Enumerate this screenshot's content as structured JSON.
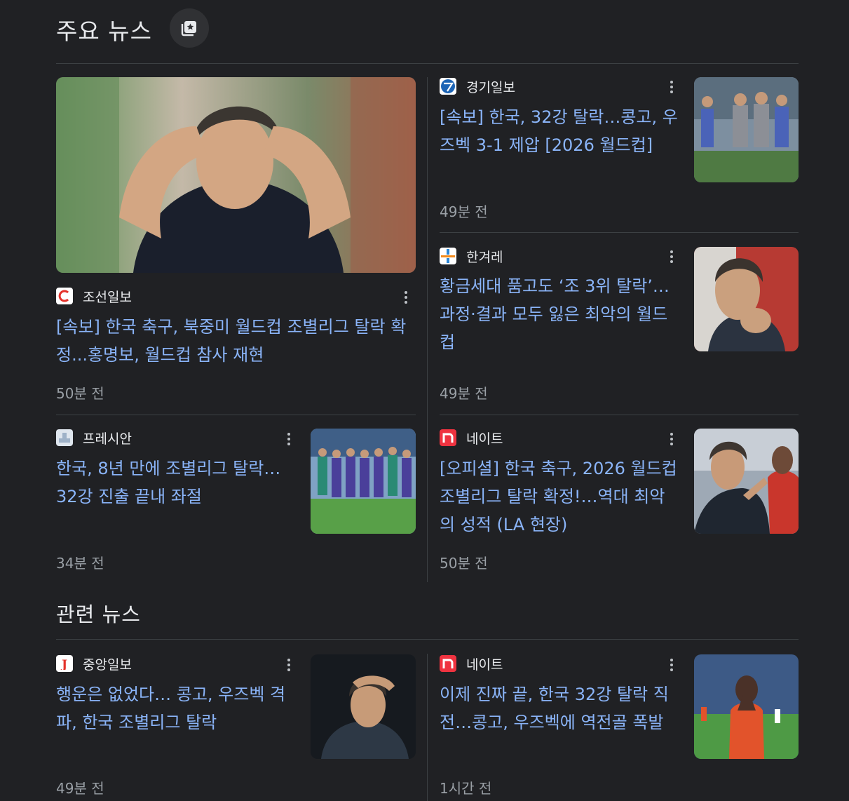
{
  "top_news": {
    "title": "주요 뉴스",
    "icon": "news-spark-icon",
    "articles": [
      {
        "source": "조선일보",
        "favicon": "chosun-logo",
        "headline": "[속보] 한국 축구, 북중미 월드컵 조별리그 탈락 확정...홍명보, 월드컵 참사 재현",
        "time": "50분 전"
      },
      {
        "source": "경기일보",
        "favicon": "kyeonggi-logo",
        "headline": "[속보] 한국, 32강 탈락…콩고, 우즈벡 3-1 제압 [2026 월드컵]",
        "time": "49분 전"
      },
      {
        "source": "한겨레",
        "favicon": "hani-logo",
        "headline": "황금세대 품고도 ‘조 3위 탈락’… 과정·결과 모두 잃은 최악의 월드컵",
        "time": "49분 전"
      },
      {
        "source": "프레시안",
        "favicon": "pressian-logo",
        "headline": "한국, 8년 만에 조별리그 탈락… 32강 진출 끝내 좌절",
        "time": "34분 전"
      },
      {
        "source": "네이트",
        "favicon": "nate-logo",
        "headline": "[오피셜] 한국 축구, 2026 월드컵 조별리그 탈락 확정!…역대 최악의 성적 (LA 현장)",
        "time": "50분 전"
      }
    ]
  },
  "related_news": {
    "title": "관련 뉴스",
    "articles": [
      {
        "source": "중앙일보",
        "favicon": "joongang-logo",
        "headline": "행운은 없었다… 콩고, 우즈벡 격파, 한국 조별리그 탈락",
        "time": "49분 전"
      },
      {
        "source": "네이트",
        "favicon": "nate-logo",
        "headline": "이제 진짜 끝, 한국 32강 탈락 직전…콩고, 우즈벡에 역전골 폭발",
        "time": "1시간 전"
      }
    ]
  },
  "colors": {
    "background": "#202124",
    "link": "#8ab4f8",
    "meta": "#9aa0a6",
    "divider": "#3c4043"
  }
}
